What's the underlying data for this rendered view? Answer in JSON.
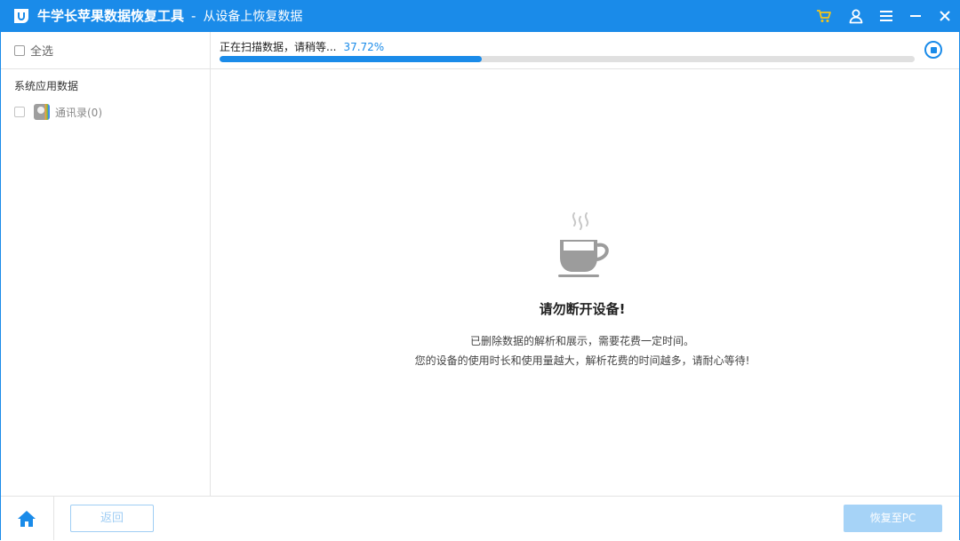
{
  "titlebar": {
    "app_name": "牛学长苹果数据恢复工具",
    "separator": "-",
    "subtitle": "从设备上恢复数据",
    "icons": [
      "cart-icon",
      "user-icon",
      "menu-icon",
      "minimize-icon",
      "close-icon"
    ],
    "accent_color": "#1a8be9",
    "cart_color": "#f5c518"
  },
  "sidebar": {
    "select_all_label": "全选",
    "category_title": "系统应用数据",
    "items": [
      {
        "label": "通讯录(0)",
        "icon": "contacts-icon",
        "checked": false
      }
    ]
  },
  "scan": {
    "status_text": "正在扫描数据，请稍等...",
    "percent_text": "37.72%",
    "progress": 0.3772
  },
  "message": {
    "title": "请勿断开设备!",
    "line1": "已删除数据的解析和展示，需要花费一定时间。",
    "line2": "您的设备的使用时长和使用量越大，解析花费的时间越多，请耐心等待!",
    "icon": "coffee-cup-icon"
  },
  "footer": {
    "home_icon": "home-icon",
    "back_label": "返回",
    "recover_label": "恢复至PC"
  }
}
